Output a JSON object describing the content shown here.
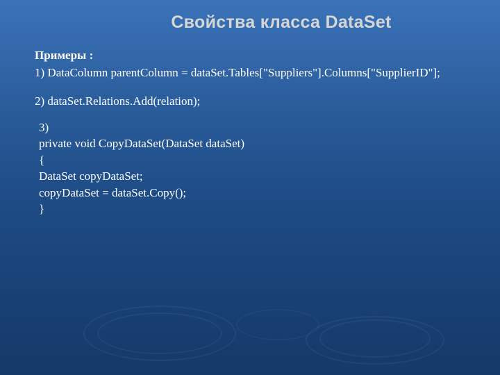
{
  "title": "Свойства класса DataSet",
  "examples": {
    "label": "Примеры :",
    "item1": "1) DataColumn parentColumn = dataSet.Tables[\"Suppliers\"].Columns[\"SupplierID\"];",
    "item2": "2) dataSet.Relations.Add(relation);",
    "item3": {
      "l1": "3)",
      "l2": "private void CopyDataSet(DataSet dataSet)",
      "l3": "{",
      "l4": "DataSet copyDataSet;",
      "l5": "copyDataSet = dataSet.Copy();",
      "l6": "}"
    }
  }
}
